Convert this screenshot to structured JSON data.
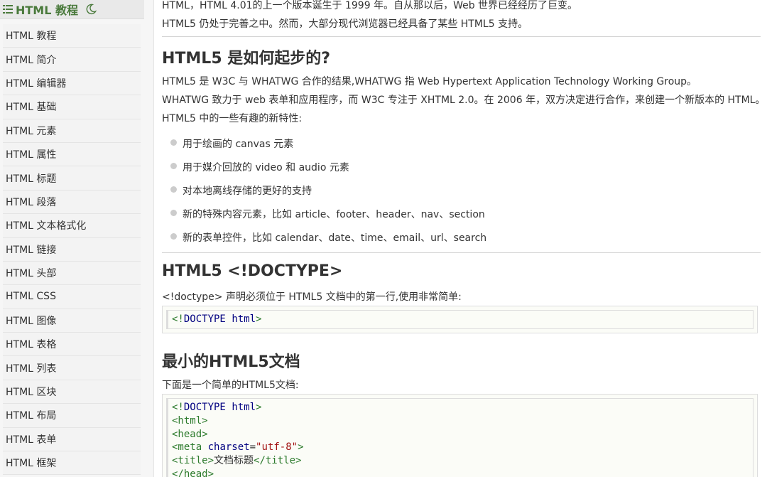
{
  "sidebar": {
    "title": "HTML 教程",
    "items": [
      "HTML 教程",
      "HTML 简介",
      "HTML 编辑器",
      "HTML 基础",
      "HTML 元素",
      "HTML 属性",
      "HTML 标题",
      "HTML 段落",
      "HTML 文本格式化",
      "HTML 链接",
      "HTML 头部",
      "HTML CSS",
      "HTML 图像",
      "HTML 表格",
      "HTML 列表",
      "HTML 区块",
      "HTML 布局",
      "HTML 表单",
      "HTML 框架"
    ]
  },
  "main": {
    "intro": [
      "HTML，HTML 4.01的上一个版本诞生于 1999 年。自从那以后，Web 世界已经经历了巨变。",
      "HTML5 仍处于完善之中。然而，大部分现代浏览器已经具备了某些 HTML5 支持。"
    ],
    "section_origin": {
      "heading": "HTML5 是如何起步的?",
      "paragraphs": [
        "HTML5 是 W3C 与 WHATWG 合作的结果,WHATWG 指 Web Hypertext Application Technology Working Group。",
        "WHATWG 致力于 web 表单和应用程序，而 W3C 专注于 XHTML 2.0。在 2006 年，双方决定进行合作，来创建一个新版本的 HTML。",
        "HTML5 中的一些有趣的新特性:"
      ],
      "features": [
        "用于绘画的 canvas 元素",
        "用于媒介回放的 video 和 audio 元素",
        "对本地离线存储的更好的支持",
        "新的特殊内容元素，比如 article、footer、header、nav、section",
        "新的表单控件，比如 calendar、date、time、email、url、search"
      ]
    },
    "section_doctype": {
      "heading": "HTML5 <!DOCTYPE>",
      "paragraph": "<!doctype> 声明必须位于 HTML5 文档中的第一行,使用非常简单:",
      "code": {
        "open": "<!",
        "keyword": "DOCTYPE",
        "attr": "html",
        "close": ">"
      }
    },
    "section_minimal": {
      "heading": "最小的HTML5文档",
      "paragraph": "下面是一个简单的HTML5文档:",
      "code_lines": {
        "line1_open": "<!",
        "line1_kw": "DOCTYPE",
        "line1_attr": "html",
        "line1_close": ">",
        "line2": "<html>",
        "line3": "<head>",
        "line4_open": "<meta",
        "line4_attr": "charset",
        "line4_eq": "=",
        "line4_val": "\"utf-8\"",
        "line4_close": ">",
        "line5_open": "<title>",
        "line5_text": "文档标题",
        "line5_close": "</title>",
        "line6": "</head>"
      }
    }
  },
  "colors": {
    "accent_green": "#4a7a3c",
    "code_tag": "#2d7b2d",
    "code_keyword": "#000080",
    "code_string": "#a31515"
  }
}
